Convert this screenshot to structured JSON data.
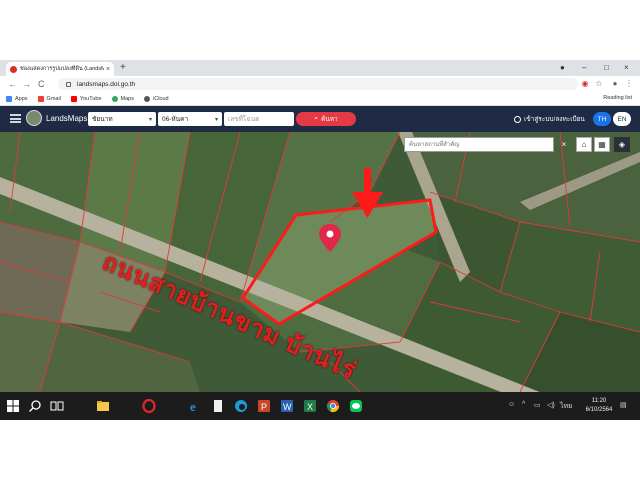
{
  "browser": {
    "tab_title": "ช่องแสดงการรูปแปลงที่ดิน (LandsMaps)",
    "tab_close": "×",
    "new_tab": "+",
    "url": "landsmaps.dol.go.th",
    "bookmarks": [
      {
        "label": "Apps",
        "icon": "apps-grid-icon",
        "color": "#4285f4"
      },
      {
        "label": "Gmail",
        "icon": "gmail-icon",
        "color": "#ea4335"
      },
      {
        "label": "YouTube",
        "icon": "youtube-icon",
        "color": "#ff0000"
      },
      {
        "label": "Maps",
        "icon": "maps-pin-icon",
        "color": "#34a853"
      },
      {
        "label": "iCloud",
        "icon": "apple-icon",
        "color": "#555555"
      }
    ],
    "reading_list": "Reading list",
    "window_controls": [
      "–",
      "□",
      "×"
    ],
    "nav": [
      "←",
      "→",
      "C"
    ]
  },
  "app": {
    "brand": "LandsMaps",
    "province_select": "ชัยนาท",
    "district_select": "06-หันคา",
    "plot_placeholder": "เลขที่โฉนด",
    "search_label": "ค้นหา",
    "login_label": "เข้าสู่ระบบ/ลงทะเบียน",
    "lang_th": "TH",
    "lang_en": "EN",
    "accent_color": "#e53945",
    "header_color": "#1f2a44"
  },
  "map": {
    "place_search_placeholder": "ค้นหาสถานที่สำคัญ",
    "close_label": "×",
    "road_label": "ถนนสายบ้านขาม บ้านไร่",
    "annotation_color": "#e02020",
    "fab_label": "•••"
  },
  "taskbar": {
    "time": "11:20",
    "date": "6/10/2564",
    "lang": "ไทย"
  }
}
